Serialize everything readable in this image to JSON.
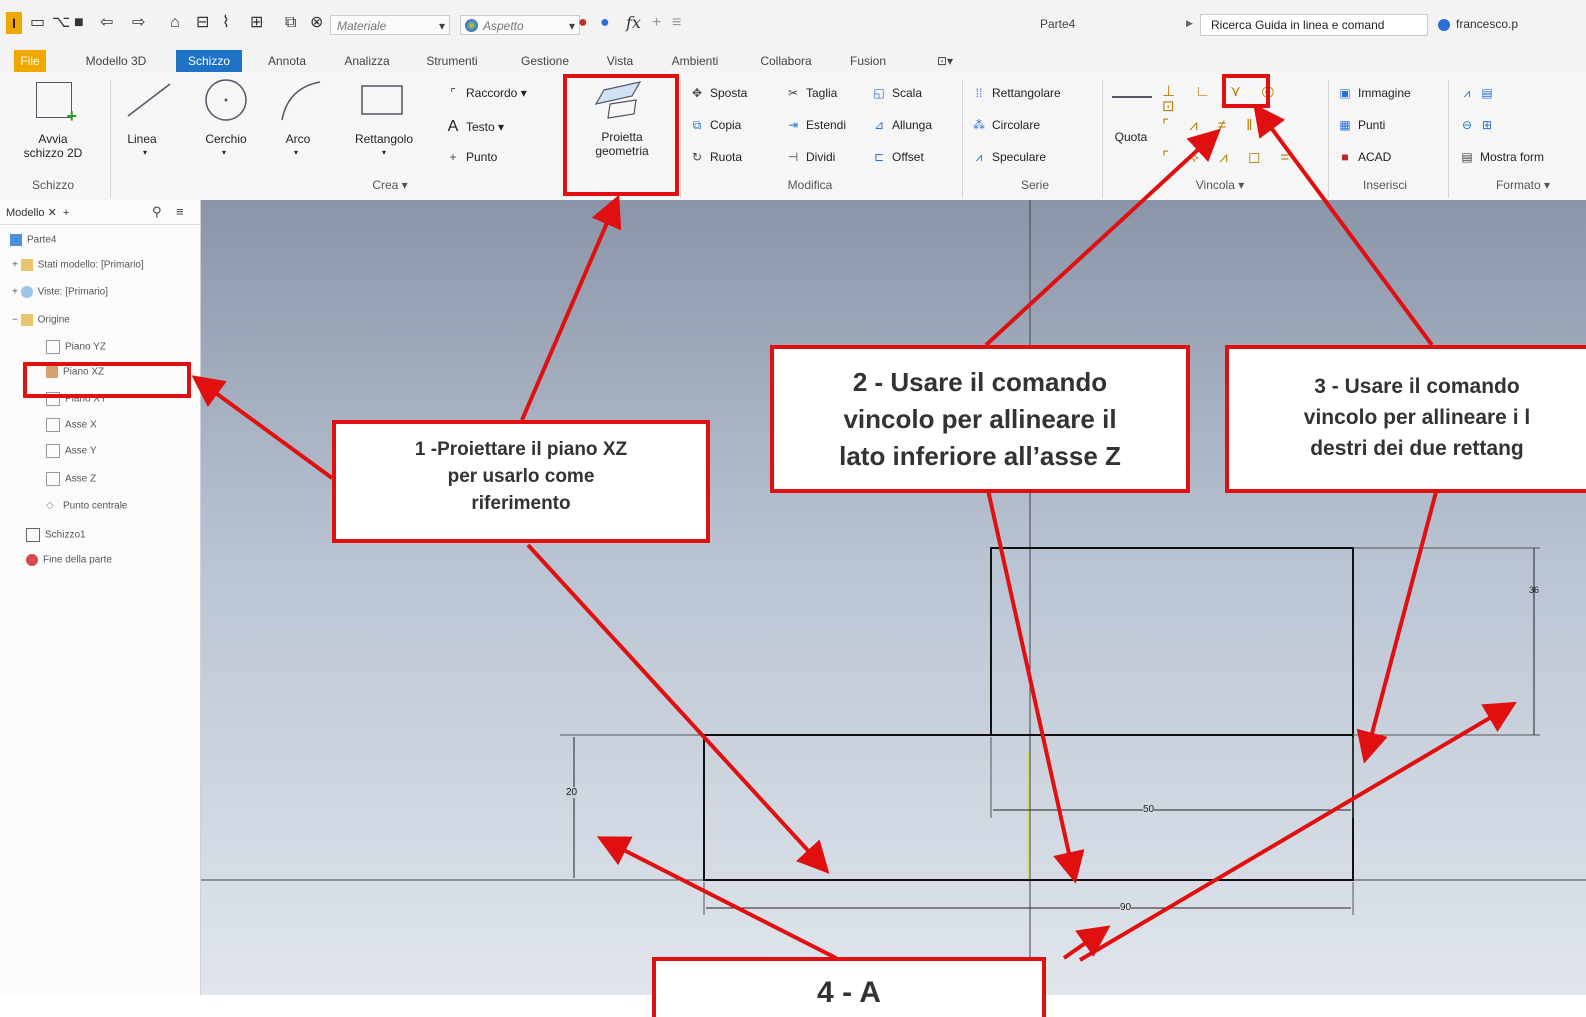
{
  "titlebar": {
    "logo": "I",
    "materials": "Materiale",
    "appearance": "Aspetto",
    "fx": "fx",
    "document": "Parte4",
    "search": "Ricerca Guida in linea e comand",
    "user": "francesco.p"
  },
  "menu": [
    "File",
    "Modello 3D",
    "Schizzo",
    "Annota",
    "Analizza",
    "Strumenti",
    "Gestione",
    "Vista",
    "Ambienti",
    "Collabora",
    "Fusion"
  ],
  "ribbon": {
    "sketch": {
      "start": "Avvia",
      "start2": "schizzo 2D",
      "group": "Schizzo"
    },
    "create": {
      "line": "Linea",
      "circle": "Cerchio",
      "arc": "Arco",
      "rect": "Rettangolo",
      "fillet": "Raccordo",
      "text": "Testo",
      "point": "Punto",
      "group": "Crea"
    },
    "project": {
      "line1": "Proietta",
      "line2": "geometria"
    },
    "modify": {
      "move": "Sposta",
      "trim": "Taglia",
      "scale": "Scala",
      "copy": "Copia",
      "extend": "Estendi",
      "stretch": "Allunga",
      "rotate": "Ruota",
      "split": "Dividi",
      "offset": "Offset",
      "group": "Modifica"
    },
    "pattern": {
      "rect": "Rettangolare",
      "circ": "Circolare",
      "mirror": "Speculare",
      "group": "Serie"
    },
    "constrain": {
      "dim": "Quota",
      "group": "Vincola"
    },
    "insert": {
      "image": "Immagine",
      "points": "Punti",
      "acad": "ACAD",
      "group": "Inserisci"
    },
    "format": {
      "show": "Mostra form",
      "group": "Formato"
    }
  },
  "browser": {
    "tab": "Modello",
    "items": [
      "Parte4",
      "Stati modello: [Primario]",
      "Viste: [Primario]",
      "Origine",
      "Piano YZ",
      "Piano XZ",
      "Piano XY",
      "Asse X",
      "Asse Y",
      "Asse Z",
      "Punto centrale",
      "Schizzo1",
      "Fine della parte"
    ]
  },
  "sketch": {
    "dim_36": "36",
    "dim_20": "20",
    "dim_50": "50",
    "dim_90": "90"
  },
  "callouts": {
    "c1": [
      "1 -Proiettare il piano  XZ",
      "per usarlo come",
      "riferimento"
    ],
    "c2": [
      "2 - Usare il comando",
      "vincolo per allineare il",
      "lato inferiore all’asse Z"
    ],
    "c3": [
      "3 - Usare il comando",
      "vincolo per allineare i l",
      "destri dei due rettang"
    ],
    "c4": "4 - A"
  },
  "colors": {
    "accent": "#1f73c6",
    "annotation": "#e01010",
    "file": "#f0a800"
  }
}
